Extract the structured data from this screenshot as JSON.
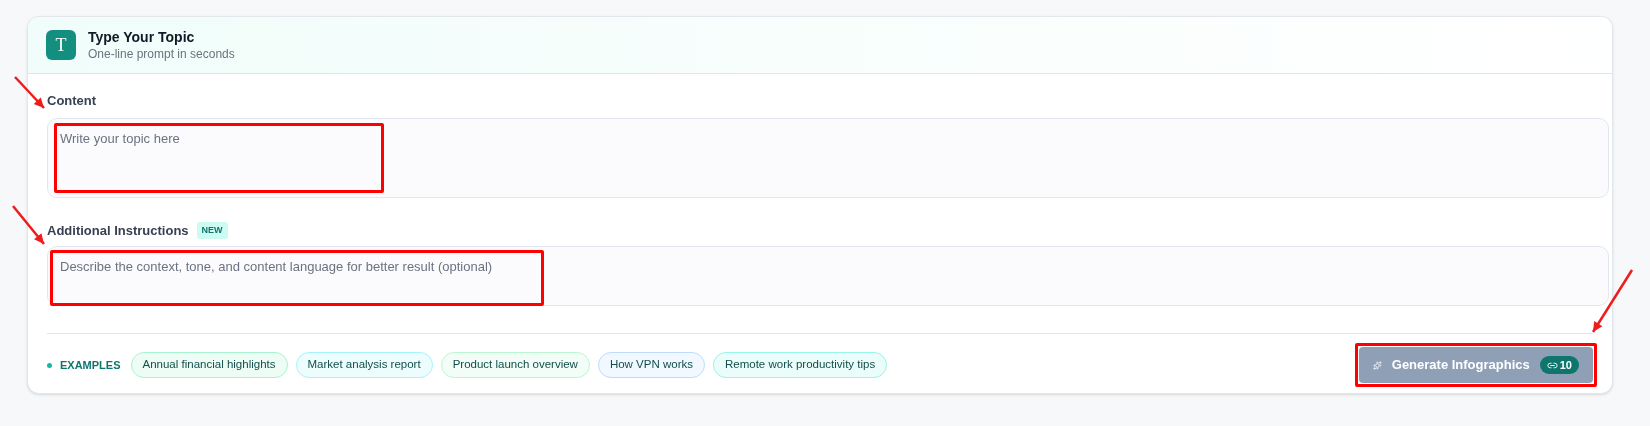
{
  "header": {
    "icon_letter": "T",
    "title": "Type Your Topic",
    "subtitle": "One-line prompt in seconds"
  },
  "content": {
    "label": "Content",
    "placeholder": "Write your topic here",
    "highlighted": true
  },
  "instructions": {
    "label": "Additional Instructions",
    "badge": "NEW",
    "placeholder": "Describe the context, tone, and content language for better result (optional)",
    "highlighted": true
  },
  "examples": {
    "label": "EXAMPLES",
    "chips": [
      {
        "label": "Annual financial highlights",
        "color": "#a7f3d0"
      },
      {
        "label": "Market analysis report",
        "color": "#a5f3fc"
      },
      {
        "label": "Product launch overview",
        "color": "#bbf7d0"
      },
      {
        "label": "How VPN works",
        "color": "#bfdbfe"
      },
      {
        "label": "Remote work productivity tips",
        "color": "#99f6e4"
      }
    ]
  },
  "generate_button": {
    "label": "Generate Infographics",
    "credits": "10",
    "disabled": true,
    "highlighted": true
  }
}
